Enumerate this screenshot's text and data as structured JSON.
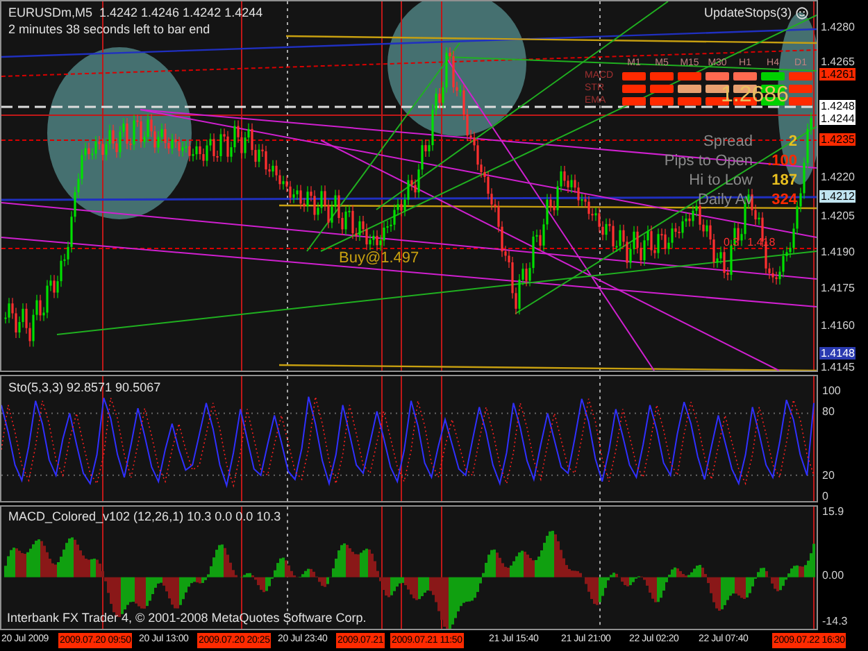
{
  "chart": {
    "title": "EURUSDm,M5  1.4242 1.4246 1.4242 1.4244",
    "timer": "2 minutes 38 seconds left to bar end",
    "expert": "UpdateStops(3)",
    "signal_panel": {
      "columns": [
        "M1",
        "M5",
        "M15",
        "M30",
        "H1",
        "H4",
        "D1"
      ],
      "rows": [
        {
          "label": "MACD",
          "cells": [
            {
              "color": "#ff2a00"
            },
            {
              "color": "#ff2a00"
            },
            {
              "color": "#ff2a00"
            },
            {
              "color": "#ff6a50"
            },
            {
              "color": "#ff6a50"
            },
            {
              "color": "#00d000"
            },
            {
              "color": "#ff2a00"
            }
          ]
        },
        {
          "label": "STR",
          "cells": [
            {
              "color": "#ff2a00"
            },
            {
              "color": "#ff2a00"
            },
            {
              "color": "#e8a070"
            },
            {
              "color": "#e8a070"
            },
            {
              "color": "#e8a070"
            },
            {
              "color": "#00d000"
            },
            {
              "color": "#ff2a00"
            }
          ]
        },
        {
          "label": "EMA",
          "cells": [
            {
              "color": "#ff2a00"
            },
            {
              "color": "#ff2a00"
            },
            {
              "color": "#ff2a00"
            },
            {
              "color": "#ff2a00"
            },
            {
              "color": "#ff2a00"
            },
            {
              "color": "#00d000"
            },
            {
              "color": "#ff2a00"
            }
          ]
        }
      ]
    },
    "big_price": "1.2686",
    "stats": [
      {
        "label": "Spread",
        "value": "2",
        "color": "#e8c020"
      },
      {
        "label": "Pips to Open",
        "value": ".100",
        "color": "#ff2a00"
      },
      {
        "label": "Hi to Low",
        "value": "187",
        "color": "#e8c020"
      },
      {
        "label": "Daily Av",
        "value": "324",
        "color": "#ff2a00"
      }
    ],
    "order_label": "Buy@1.497",
    "line_labels": [
      "0.3",
      "1.418"
    ],
    "price_axis": [
      {
        "text": "1.4280",
        "kind": "tick"
      },
      {
        "text": "1.4265",
        "kind": "tick"
      },
      {
        "text": "1.4261",
        "kind": "tag",
        "color": "#ff2a00"
      },
      {
        "text": "1.4248",
        "kind": "tag",
        "color": "#ffffff"
      },
      {
        "text": "1.4244",
        "kind": "tag",
        "color": "#ffffff"
      },
      {
        "text": "1.4235",
        "kind": "tag",
        "color": "#ff2a00"
      },
      {
        "text": "1.4220",
        "kind": "tick"
      },
      {
        "text": "1.4212",
        "kind": "tag",
        "color": "#c0e4f0"
      },
      {
        "text": "1.4205",
        "kind": "tick"
      },
      {
        "text": "1.4190",
        "kind": "tick"
      },
      {
        "text": "1.4175",
        "kind": "tick"
      },
      {
        "text": "1.4160",
        "kind": "tick"
      },
      {
        "text": "1.4148",
        "kind": "tag",
        "color": "#2a3ab0"
      },
      {
        "text": "1.4145",
        "kind": "tick"
      }
    ]
  },
  "stochastic": {
    "label": "Sto(5,3,3) 92.8571 90.5067",
    "chart_data": {
      "type": "line",
      "yticks": [
        {
          "value": 100,
          "label": "100"
        },
        {
          "value": 80,
          "label": "80"
        },
        {
          "value": 20,
          "label": "20"
        },
        {
          "value": 0,
          "label": "0"
        }
      ],
      "ylim": [
        -5,
        116
      ],
      "series": [
        {
          "color": "#3030ff",
          "line_style": "solid",
          "values": [
            88,
            62,
            30,
            15,
            48,
            92,
            70,
            35,
            20,
            55,
            80,
            50,
            22,
            12,
            40,
            95,
            75,
            40,
            18,
            50,
            85,
            58,
            28,
            14,
            45,
            70,
            45,
            25,
            30,
            60,
            90,
            65,
            30,
            10,
            42,
            84,
            55,
            26,
            20,
            50,
            78,
            52,
            24,
            16,
            46,
            96,
            70,
            34,
            12,
            40,
            88,
            60,
            30,
            22,
            52,
            82,
            56,
            28,
            14,
            44,
            92,
            68,
            32,
            18,
            48,
            74,
            50,
            26,
            20,
            54,
            86,
            62,
            30,
            12,
            42,
            90,
            66,
            34,
            16,
            50,
            80,
            54,
            28,
            22,
            56,
            94,
            72,
            36,
            14,
            44,
            84,
            58,
            30,
            18,
            50,
            88,
            64,
            32,
            20,
            60,
            91,
            70,
            38,
            16,
            48,
            78,
            52,
            26,
            12,
            40,
            86,
            60,
            30,
            18,
            52,
            93,
            74,
            40,
            20,
            90
          ]
        },
        {
          "color": "#ff2020",
          "line_style": "dashed",
          "values": [
            45,
            88,
            62,
            30,
            15,
            48,
            92,
            70,
            35,
            20,
            55,
            80,
            50,
            22,
            12,
            40,
            95,
            75,
            40,
            18,
            50,
            85,
            58,
            28,
            14,
            45,
            70,
            45,
            25,
            30,
            60,
            90,
            65,
            30,
            10,
            42,
            84,
            55,
            26,
            20,
            50,
            78,
            52,
            24,
            16,
            46,
            96,
            70,
            34,
            12,
            40,
            88,
            60,
            30,
            22,
            52,
            82,
            56,
            28,
            14,
            44,
            92,
            68,
            32,
            18,
            48,
            74,
            50,
            26,
            20,
            54,
            86,
            62,
            30,
            12,
            42,
            90,
            66,
            34,
            16,
            50,
            80,
            54,
            28,
            22,
            56,
            94,
            72,
            36,
            14,
            44,
            84,
            58,
            30,
            18,
            50,
            88,
            64,
            32,
            20,
            60,
            91,
            70,
            38,
            16,
            48,
            78,
            52,
            26,
            12,
            40,
            86,
            60,
            30,
            18,
            52,
            93,
            74,
            40,
            20
          ]
        }
      ]
    }
  },
  "macd": {
    "label": "MACD_Colored_v102 (12,26,1) 10.3 0.0 0.0 10.3",
    "axis": [
      "15.9",
      "0.00",
      "-14.3"
    ]
  },
  "copyright": "Interbank FX Trader 4, © 2001-2008 MetaQuotes Software Corp.",
  "time_axis": [
    {
      "text": "20 Jul 2009",
      "kind": "tick"
    },
    {
      "text": "2009.07.20 09:50",
      "kind": "tag"
    },
    {
      "text": "20 Jul 13:00",
      "kind": "tick"
    },
    {
      "text": "2009.07.20 20:25",
      "kind": "tag"
    },
    {
      "text": "20 Jul 23:40",
      "kind": "tick"
    },
    {
      "text": "2009.07.21",
      "kind": "tag"
    },
    {
      "text": "2009.07.21 11:50",
      "kind": "tag"
    },
    {
      "text": "21 Jul 15:40",
      "kind": "tick"
    },
    {
      "text": "21 Jul 21:00",
      "kind": "tick"
    },
    {
      "text": "22 Jul 02:20",
      "kind": "tick"
    },
    {
      "text": "22 Jul 07:40",
      "kind": "tick"
    },
    {
      "text": "2009.07.22 16:30",
      "kind": "tag"
    }
  ]
}
